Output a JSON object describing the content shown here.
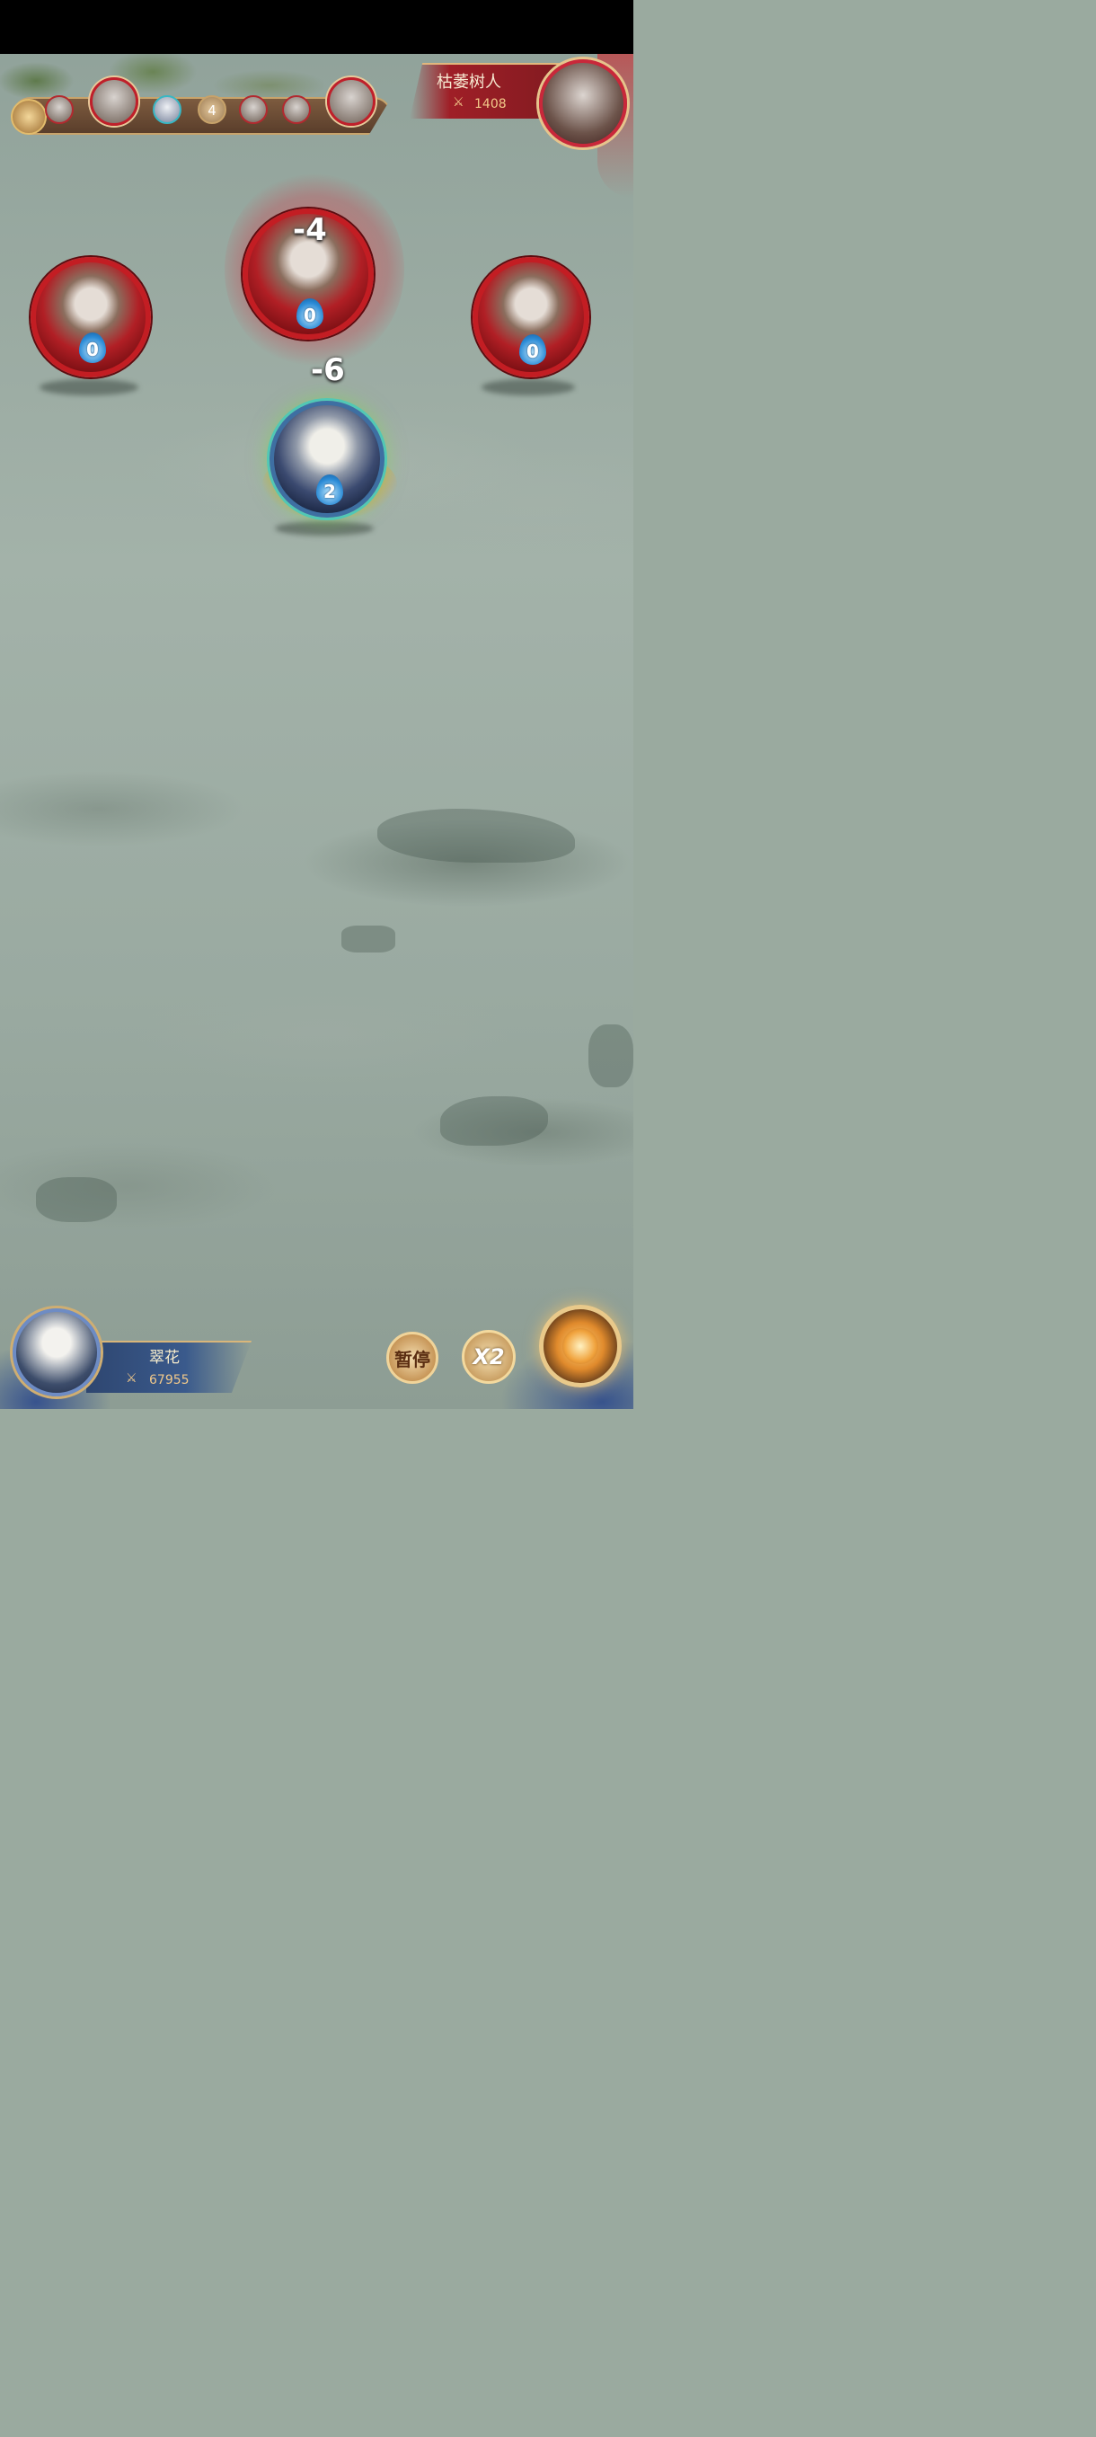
{
  "turn_order": {
    "icons": [
      "enemy-small",
      "enemy-big",
      "ally",
      "counter",
      "enemy-small",
      "enemy-small",
      "enemy-big"
    ],
    "round_count": "4"
  },
  "enemy_target": {
    "name": "枯萎树人",
    "power": "1408",
    "power_icon": "crossed-swords-icon"
  },
  "battlefield": {
    "enemies": [
      {
        "id": "left",
        "energy": "0"
      },
      {
        "id": "center",
        "energy": "0",
        "damage": "-4"
      },
      {
        "id": "right",
        "energy": "0"
      }
    ],
    "hero": {
      "energy": "2",
      "damage": "-6"
    }
  },
  "player": {
    "name": "翠花",
    "power": "67955",
    "power_icon": "crossed-swords-icon"
  },
  "controls": {
    "pause_label": "暂停",
    "speed_label": "X2",
    "skill_icon": "ultimate-skill-icon"
  }
}
